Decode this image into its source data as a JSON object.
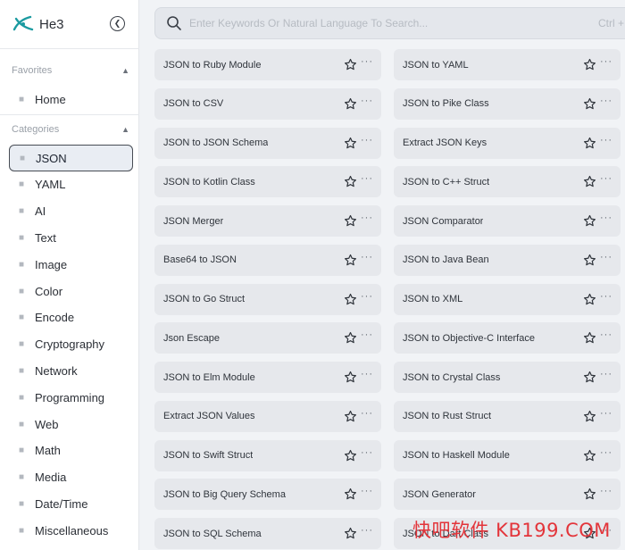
{
  "app": {
    "name": "He3",
    "accent": "#1a9aa0"
  },
  "sidebar": {
    "favorites_title": "Favorites",
    "categories_title": "Categories",
    "favorites": [
      {
        "label": "Home",
        "icon": "home-icon"
      }
    ],
    "categories": [
      {
        "label": "JSON",
        "icon": "file-icon",
        "active": true
      },
      {
        "label": "YAML",
        "icon": "file-icon"
      },
      {
        "label": "AI",
        "icon": "ai-icon"
      },
      {
        "label": "Text",
        "icon": "text-icon"
      },
      {
        "label": "Image",
        "icon": "image-icon"
      },
      {
        "label": "Color",
        "icon": "color-icon"
      },
      {
        "label": "Encode",
        "icon": "encode-icon"
      },
      {
        "label": "Cryptography",
        "icon": "cryptography-icon"
      },
      {
        "label": "Network",
        "icon": "network-icon"
      },
      {
        "label": "Programming",
        "icon": "programming-icon"
      },
      {
        "label": "Web",
        "icon": "web-icon"
      },
      {
        "label": "Math",
        "icon": "math-icon"
      },
      {
        "label": "Media",
        "icon": "media-icon"
      },
      {
        "label": "Date/Time",
        "icon": "datetime-icon"
      },
      {
        "label": "Miscellaneous",
        "icon": "miscellaneous-icon"
      }
    ]
  },
  "search": {
    "placeholder": "Enter Keywords Or Natural Language To Search...",
    "value": "",
    "shortcut": "Ctrl + K"
  },
  "tools": [
    "JSON to Ruby Module",
    "JSON to YAML",
    "JSON to CSV",
    "JSON to Pike Class",
    "JSON to JSON Schema",
    "Extract JSON Keys",
    "JSON to Kotlin Class",
    "JSON to C++ Struct",
    "JSON Merger",
    "JSON Comparator",
    "Base64 to JSON",
    "JSON to Java Bean",
    "JSON to Go Struct",
    "JSON to XML",
    "Json Escape",
    "JSON to Objective-C Interface",
    "JSON to Elm Module",
    "JSON to Crystal Class",
    "Extract JSON Values",
    "JSON to Rust Struct",
    "JSON to Swift Struct",
    "JSON to Haskell Module",
    "JSON to Big Query Schema",
    "JSON Generator",
    "JSON to SQL Schema",
    "JSON to Dart Class"
  ],
  "watermark": "快吧软件 KB199.COM"
}
